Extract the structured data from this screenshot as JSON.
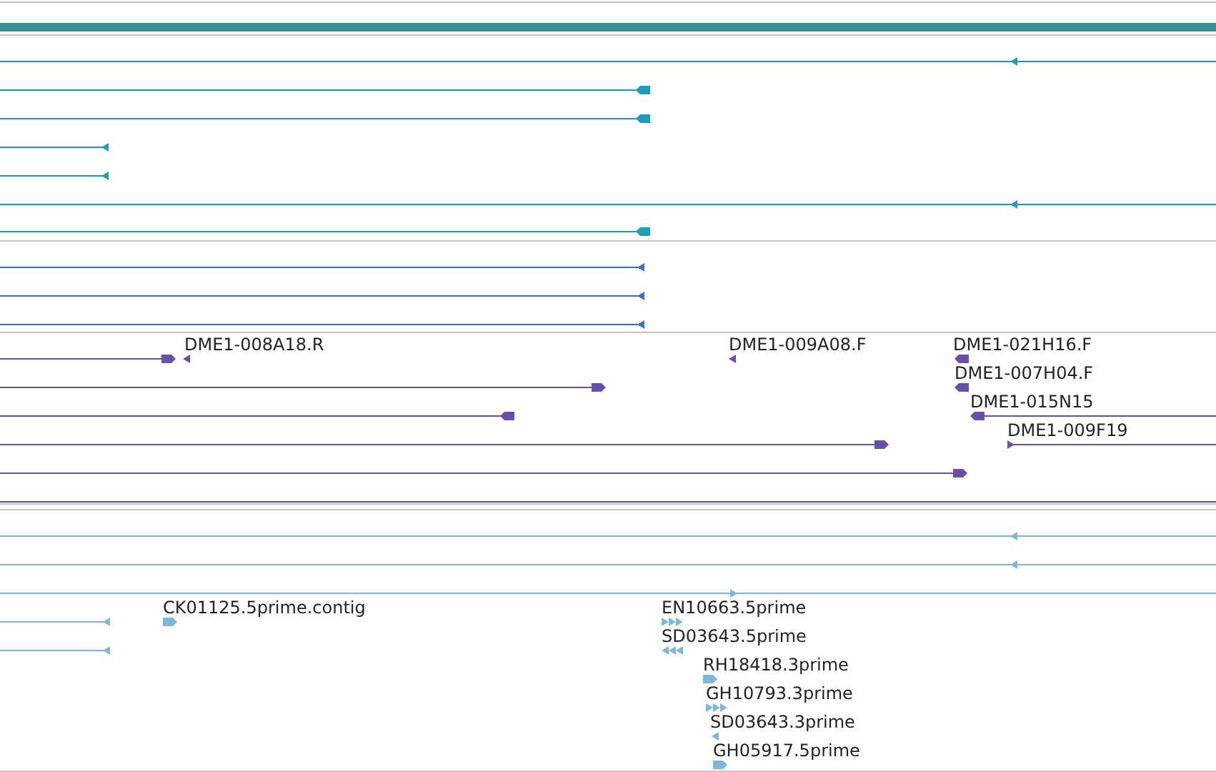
{
  "tracks": [
    {
      "color": "#1a9ec0",
      "features": [
        {
          "kind": "arrow",
          "forward": false
        },
        {
          "kind": "block",
          "forward": false
        },
        {
          "kind": "block",
          "forward": false
        },
        {
          "kind": "arrow",
          "forward": false
        },
        {
          "kind": "arrow",
          "forward": false
        },
        {
          "kind": "arrow",
          "forward": false
        },
        {
          "kind": "block",
          "forward": false
        }
      ]
    },
    {
      "color": "#3a6fd0",
      "features": [
        {
          "kind": "arrow",
          "forward": false
        },
        {
          "kind": "arrow",
          "forward": false
        },
        {
          "kind": "arrow",
          "forward": false
        }
      ]
    },
    {
      "color": "#6a4fa8",
      "features": [
        {
          "kind": "block",
          "forward": true
        },
        {
          "kind": "arrow",
          "forward": false,
          "label": "DME1-008A18.R"
        },
        {
          "kind": "arrow",
          "forward": false,
          "label": "DME1-009A08.F"
        },
        {
          "kind": "block",
          "forward": false,
          "label": "DME1-021H16.F"
        },
        {
          "kind": "block",
          "forward": true
        },
        {
          "kind": "block",
          "forward": false,
          "label": "DME1-007H04.F"
        },
        {
          "kind": "block",
          "forward": false
        },
        {
          "kind": "block",
          "forward": false,
          "label": "DME1-015N15"
        },
        {
          "kind": "block",
          "forward": true
        },
        {
          "kind": "arrow",
          "forward": true,
          "label": "DME1-009F19"
        },
        {
          "kind": "block",
          "forward": true
        },
        {
          "kind": "line"
        }
      ]
    },
    {
      "color": "#7fb6dc",
      "features": [
        {
          "kind": "arrow",
          "forward": false
        },
        {
          "kind": "arrow",
          "forward": false
        },
        {
          "kind": "arrow",
          "forward": true
        },
        {
          "kind": "arrow",
          "forward": false
        },
        {
          "kind": "block",
          "forward": true,
          "label": "CK01125.5prime.contig"
        },
        {
          "kind": "multi",
          "forward": true,
          "label": "EN10663.5prime"
        },
        {
          "kind": "arrow",
          "forward": false
        },
        {
          "kind": "multi",
          "forward": false,
          "label": "SD03643.5prime"
        },
        {
          "kind": "block",
          "forward": true,
          "label": "RH18418.3prime"
        },
        {
          "kind": "multi",
          "forward": true,
          "label": "GH10793.3prime"
        },
        {
          "kind": "arrow",
          "forward": false,
          "label": "SD03643.3prime"
        },
        {
          "kind": "block",
          "forward": true,
          "label": "GH05917.5prime"
        }
      ]
    }
  ]
}
